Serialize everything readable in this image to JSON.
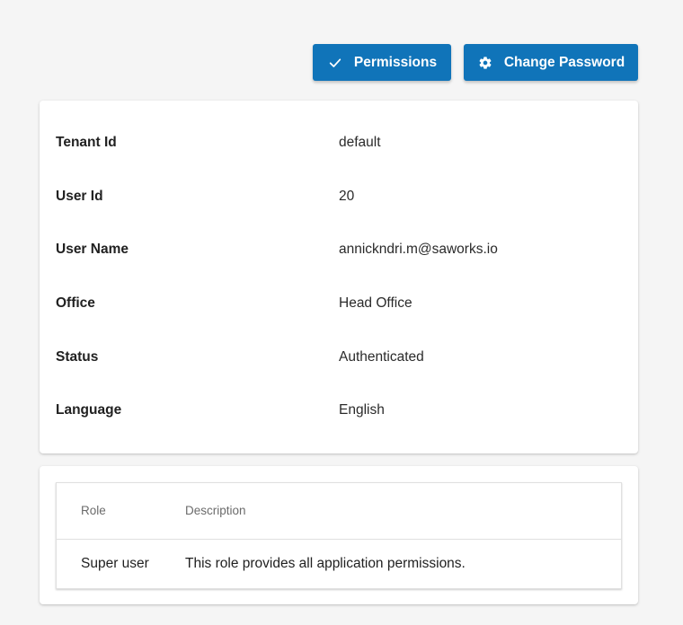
{
  "toolbar": {
    "permissions_label": "Permissions",
    "change_password_label": "Change Password",
    "accent_color": "#1074b9",
    "permissions_icon": "checkmark-icon",
    "change_password_icon": "gear-icon"
  },
  "details": [
    {
      "label": "Tenant Id",
      "value": "default"
    },
    {
      "label": "User Id",
      "value": "20"
    },
    {
      "label": "User Name",
      "value": "annickndri.m@saworks.io"
    },
    {
      "label": "Office",
      "value": "Head Office"
    },
    {
      "label": "Status",
      "value": "Authenticated"
    },
    {
      "label": "Language",
      "value": "English"
    }
  ],
  "roles": {
    "columns": [
      "Role",
      "Description"
    ],
    "rows": [
      {
        "role": "Super user",
        "description": "This role provides all application permissions."
      }
    ]
  }
}
